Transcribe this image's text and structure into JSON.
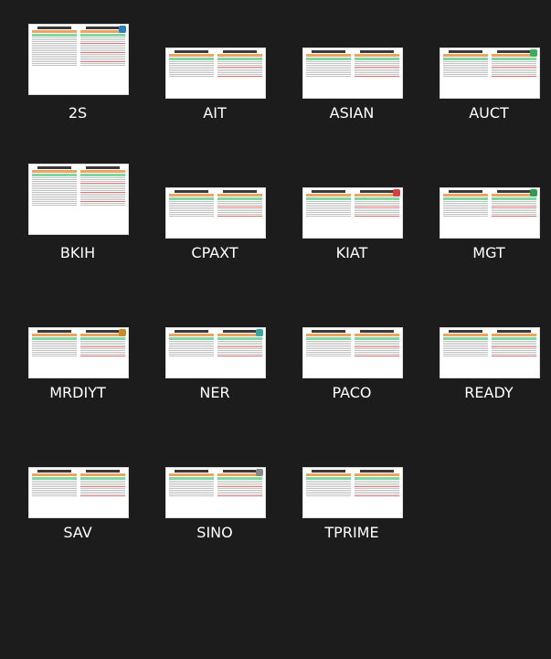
{
  "files": [
    {
      "label": "2S"
    },
    {
      "label": "AIT"
    },
    {
      "label": "ASIAN"
    },
    {
      "label": "AUCT"
    },
    {
      "label": "BKIH"
    },
    {
      "label": "CPAXT"
    },
    {
      "label": "KIAT"
    },
    {
      "label": "MGT"
    },
    {
      "label": "MRDIYT"
    },
    {
      "label": "NER"
    },
    {
      "label": "PACO"
    },
    {
      "label": "READY"
    },
    {
      "label": "SAV"
    },
    {
      "label": "SINO"
    },
    {
      "label": "TPRIME"
    }
  ],
  "colors": {
    "background": "#1c1c1c",
    "label": "#ffffff",
    "band_orange": "#f0a35e",
    "band_green": "#7ed6a0"
  }
}
